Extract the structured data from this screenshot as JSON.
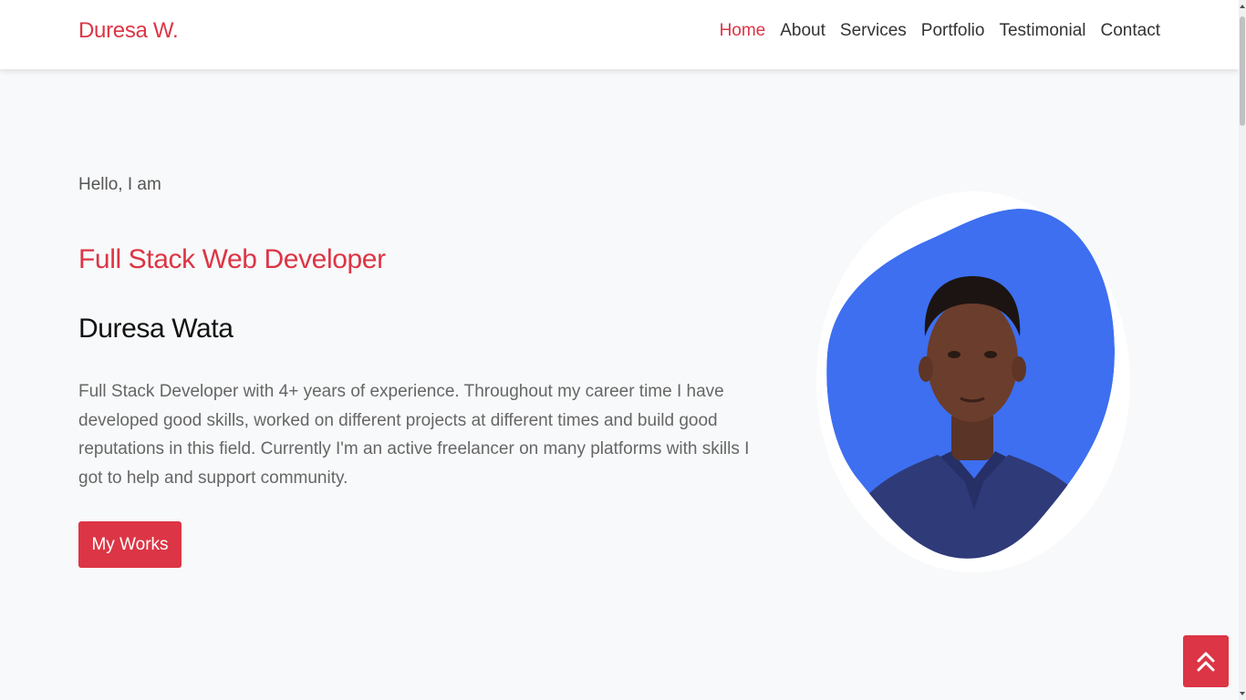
{
  "brand": "Duresa W.",
  "nav": {
    "items": [
      {
        "label": "Home",
        "active": true
      },
      {
        "label": "About",
        "active": false
      },
      {
        "label": "Services",
        "active": false
      },
      {
        "label": "Portfolio",
        "active": false
      },
      {
        "label": "Testimonial",
        "active": false
      },
      {
        "label": "Contact",
        "active": false
      }
    ]
  },
  "hero": {
    "greeting": "Hello, I am",
    "role": "Full Stack Web Developer",
    "name": "Duresa Wata",
    "bio": "Full Stack Developer with 4+ years of experience. Throughout my career time I have developed good skills, worked on different projects at different times and build good reputations in this field. Currently I'm an active freelancer on many platforms with skills I got to help and support community.",
    "button_label": "My Works"
  },
  "icons": {
    "back_to_top": "double-chevron-up-icon"
  },
  "colors": {
    "accent": "#dc3545",
    "blob": "#3d6ff0",
    "background": "#f8f9fa"
  }
}
